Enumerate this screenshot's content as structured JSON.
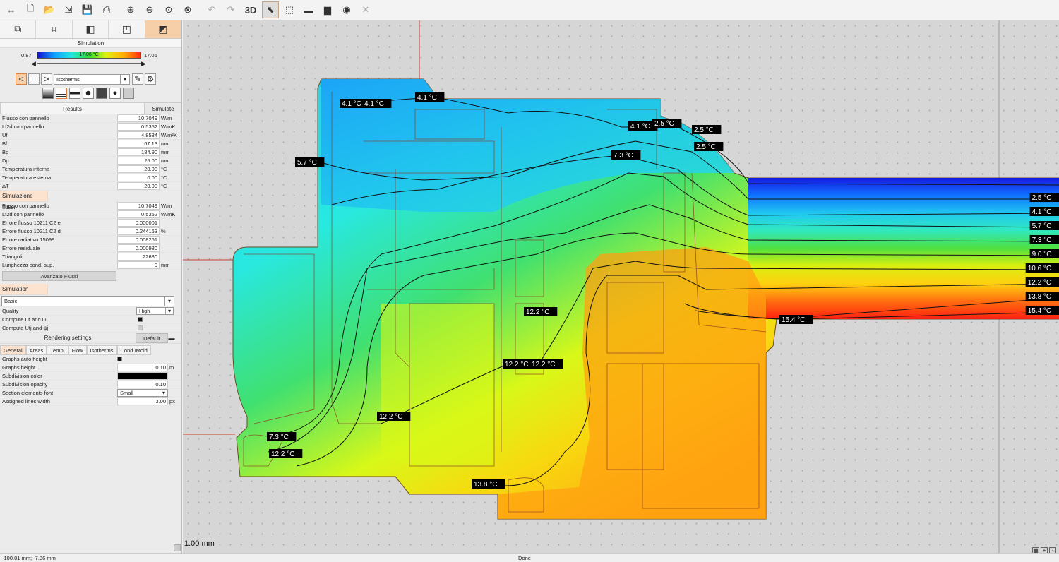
{
  "toolbar": {
    "items": [
      {
        "name": "swap-icon",
        "glyph": "⇔"
      },
      {
        "name": "new-file-icon",
        "glyph": "🗋"
      },
      {
        "name": "open-folder-icon",
        "glyph": "📂"
      },
      {
        "name": "import-icon",
        "glyph": "⇲"
      },
      {
        "name": "save-icon",
        "glyph": "💾"
      },
      {
        "name": "print-icon",
        "glyph": "⎙"
      },
      {
        "name": "zoom-in-icon",
        "glyph": "⊕"
      },
      {
        "name": "zoom-out-icon",
        "glyph": "⊖"
      },
      {
        "name": "zoom-fit-icon",
        "glyph": "⊙"
      },
      {
        "name": "zoom-reset-icon",
        "glyph": "⊗"
      },
      {
        "name": "undo-icon",
        "glyph": "↶"
      },
      {
        "name": "redo-icon",
        "glyph": "↷"
      }
    ],
    "view3d": "3D",
    "tools": [
      {
        "name": "pointer-icon",
        "glyph": "⬉"
      },
      {
        "name": "select-area-icon",
        "glyph": "⬚"
      },
      {
        "name": "ruler-icon",
        "glyph": "▬"
      },
      {
        "name": "comment-icon",
        "glyph": "▆"
      },
      {
        "name": "eye-icon",
        "glyph": "◉"
      },
      {
        "name": "hide-icon",
        "glyph": "✕"
      }
    ]
  },
  "panel": {
    "mode_tabs": [
      {
        "name": "geometry-mode-icon",
        "glyph": "⧉"
      },
      {
        "name": "crop-mode-icon",
        "glyph": "⌗"
      },
      {
        "name": "materials-mode-icon",
        "glyph": "◧"
      },
      {
        "name": "boundary-mode-icon",
        "glyph": "◰"
      },
      {
        "name": "simulation-mode-icon",
        "glyph": "◩"
      }
    ],
    "simulation_title": "Simulation",
    "legend": {
      "min": "0.87",
      "max": "17.06",
      "current": "17.06 °C"
    },
    "display_mode": "Isotherms",
    "results_tab": "Results",
    "simulate_btn": "Simulate",
    "results": [
      {
        "label": "Flusso con pannello",
        "value": "10.7049",
        "unit": "W/m"
      },
      {
        "label": "Lf2d con pannello",
        "value": "0.5352",
        "unit": "W/mK"
      },
      {
        "label": "Uf",
        "value": "4.8584",
        "unit": "W/m²K"
      },
      {
        "label": "Bf",
        "value": "67.13",
        "unit": "mm"
      },
      {
        "label": "Bp",
        "value": "184.90",
        "unit": "mm"
      },
      {
        "label": "Dp",
        "value": "25.00",
        "unit": "mm"
      },
      {
        "label": "Temperatura interna",
        "value": "20.00",
        "unit": "°C"
      },
      {
        "label": "Temperatura esterna",
        "value": "0.00",
        "unit": "°C"
      },
      {
        "label": "ΔT",
        "value": "20.00",
        "unit": "°C"
      }
    ],
    "flow_section": "Simulazione flussi",
    "flow": [
      {
        "label": "Flusso con pannello",
        "value": "10.7049",
        "unit": "W/m"
      },
      {
        "label": "Lf2d con pannello",
        "value": "0.5352",
        "unit": "W/mK"
      },
      {
        "label": "Errore flusso 10211 C2 e",
        "value": "0.000001",
        "unit": ""
      },
      {
        "label": "Errore flusso 10211 C2 d",
        "value": "0.244163",
        "unit": "%"
      },
      {
        "label": "Errore radiativo 15099",
        "value": "0.008261",
        "unit": ""
      },
      {
        "label": "Errore residuale",
        "value": "0.000980",
        "unit": ""
      },
      {
        "label": "Triangoli",
        "value": "22680",
        "unit": ""
      },
      {
        "label": "Lunghezza cond. sup.",
        "value": "0",
        "unit": "mm"
      }
    ],
    "advanced_btn": "Avanzato Flussi",
    "sim_settings": "Simulation settings",
    "preset": "Basic",
    "quality_label": "Quality",
    "quality_value": "High",
    "compute_uf": "Compute Uf and ψ",
    "compute_utj": "Compute Utj and ψj",
    "rendering_settings": "Rendering settings",
    "default_btn": "Default",
    "render_tabs": [
      "General",
      "Areas",
      "Temp.",
      "Flow",
      "Isotherms",
      "Cond./Mold"
    ],
    "render": [
      {
        "label": "Graphs auto height",
        "value": "",
        "unit": ""
      },
      {
        "label": "Graphs height",
        "value": "0.10",
        "unit": "m"
      },
      {
        "label": "Subdivision color",
        "value": "",
        "unit": ""
      },
      {
        "label": "Subdivision opacity",
        "value": "0.10",
        "unit": ""
      },
      {
        "label": "Section elements font",
        "value": "Small",
        "unit": ""
      },
      {
        "label": "Assigned lines width",
        "value": "3.00",
        "unit": "px"
      }
    ]
  },
  "canvas": {
    "scale": "1.00 mm",
    "isotherm_labels": [
      "4.1 °C",
      "4.1 °C",
      "4.1 °C",
      "4.1 °C",
      "2.5 °C",
      "2.5 °C",
      "2.5 °C",
      "5.7 °C",
      "7.3 °C",
      "12.2 °C",
      "12.2 °C",
      "12.2 °C",
      "12.2 °C",
      "7.3 °C",
      "12.2 °C",
      "13.8 °C",
      "15.4 °C"
    ],
    "edge_labels": [
      "2.5 °C",
      "4.1 °C",
      "5.7 °C",
      "7.3 °C",
      "9.0 °C",
      "10.6 °C",
      "12.2 °C",
      "13.8 °C",
      "15.4 °C"
    ]
  },
  "status": {
    "coords": "-100.01 mm; -7.36 mm",
    "message": "Done"
  }
}
